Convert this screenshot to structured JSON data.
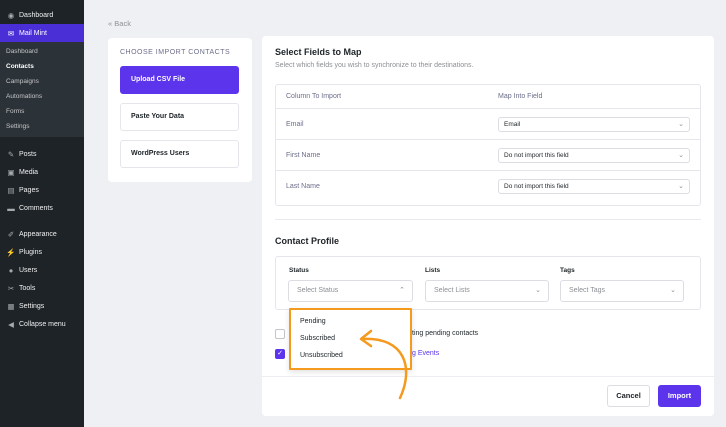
{
  "sidebar": {
    "top_items": [
      {
        "label": "Dashboard",
        "icon": "dashboard-icon",
        "glyph": "◉"
      },
      {
        "label": "Mail Mint",
        "icon": "mail-icon",
        "glyph": "✉"
      }
    ],
    "submenu": [
      "Dashboard",
      "Contacts",
      "Campaigns",
      "Automations",
      "Forms",
      "Settings"
    ],
    "items_a": [
      {
        "label": "Posts",
        "icon": "pin-icon",
        "glyph": "✎"
      },
      {
        "label": "Media",
        "icon": "media-icon",
        "glyph": "▣"
      },
      {
        "label": "Pages",
        "icon": "pages-icon",
        "glyph": "▤"
      },
      {
        "label": "Comments",
        "icon": "comments-icon",
        "glyph": "▬"
      }
    ],
    "items_b": [
      {
        "label": "Appearance",
        "icon": "brush-icon",
        "glyph": "✐"
      },
      {
        "label": "Plugins",
        "icon": "plugin-icon",
        "glyph": "⚡"
      },
      {
        "label": "Users",
        "icon": "user-icon",
        "glyph": "●"
      },
      {
        "label": "Tools",
        "icon": "wrench-icon",
        "glyph": "✂"
      },
      {
        "label": "Settings",
        "icon": "settings-icon",
        "glyph": "▦"
      },
      {
        "label": "Collapse menu",
        "icon": "collapse-icon",
        "glyph": "◀"
      }
    ]
  },
  "back_label": "Back",
  "import_panel": {
    "heading": "CHOOSE IMPORT CONTACTS",
    "options": [
      "Upload CSV File",
      "Paste Your Data",
      "WordPress Users"
    ]
  },
  "map": {
    "title": "Select Fields to Map",
    "description": "Select which fields you wish to synchronize to their destinations.",
    "col_import": "Column To Import",
    "col_map": "Map Into Field",
    "rows": [
      {
        "label": "Email",
        "value": "Email"
      },
      {
        "label": "First Name",
        "value": "Do not import this field"
      },
      {
        "label": "Last Name",
        "value": "Do not import this field"
      }
    ]
  },
  "profile": {
    "title": "Contact Profile",
    "status_label": "Status",
    "status_placeholder": "Select Status",
    "lists_label": "Lists",
    "lists_placeholder": "Select Lists",
    "tags_label": "Tags",
    "tags_placeholder": "Select Tags"
  },
  "status_options": [
    "Pending",
    "Subscribed",
    "Unsubscribed"
  ],
  "checkbox1_tail": "ting pending contacts",
  "checkbox2_tail": "g Events",
  "buttons": {
    "cancel": "Cancel",
    "import": "Import"
  },
  "colors": {
    "accent": "#5b34ec",
    "highlight": "#f39a1f",
    "sidebar": "#1d2327"
  }
}
